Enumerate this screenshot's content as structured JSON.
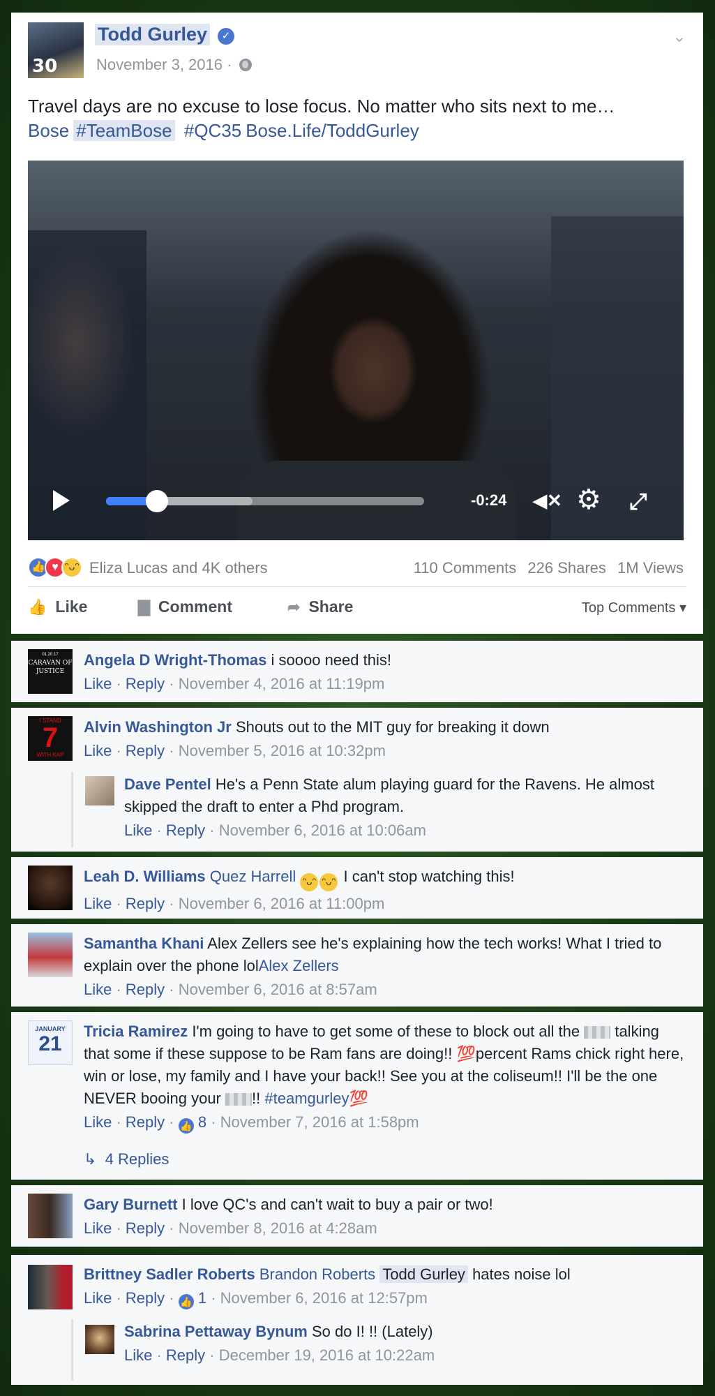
{
  "post": {
    "author": "Todd Gurley",
    "verified_icon": "✓",
    "jersey": "30",
    "date": "November 3, 2016 ·",
    "text": "Travel days are no excuse to lose focus. No matter who sits next to me…",
    "links": [
      "Bose",
      "#TeamBose",
      "#QC35",
      "Bose.Life/ToddGurley"
    ],
    "video": {
      "time_left": "-0:24",
      "progress": 0.16,
      "buffered": 0.46
    },
    "reactions_text": "Eliza Lucas and 4K others",
    "comments_count": "110 Comments",
    "shares_count": "226 Shares",
    "views_count": "1M Views",
    "actions": {
      "like": "Like",
      "comment": "Comment",
      "share": "Share",
      "sort": "Top Comments ▾"
    }
  },
  "comments": [
    {
      "name": "Angela D Wright-Thomas",
      "text": "i soooo need this!",
      "like": "Like",
      "reply": "Reply",
      "date": "November 4, 2016 at 11:19pm"
    },
    {
      "name": "Alvin Washington Jr",
      "text": "Shouts out to the MIT guy for breaking it down",
      "like": "Like",
      "reply": "Reply",
      "date": "November 5, 2016 at 10:32pm",
      "reply_comment": {
        "name": "Dave Pentel",
        "text": "He's a Penn State alum playing guard for the Ravens. He almost skipped the draft to enter a Phd program.",
        "like": "Like",
        "reply": "Reply",
        "date": "November 6, 2016 at 10:06am"
      }
    },
    {
      "name": "Leah D. Williams",
      "tag": "Quez Harrell",
      "text": "I can't stop watching this!",
      "like": "Like",
      "reply": "Reply",
      "date": "November 6, 2016 at 11:00pm"
    },
    {
      "name": "Samantha Khani",
      "text": "Alex Zellers see he's explaining how the tech works! What I tried to explain over the phone lol",
      "tag": "Alex Zellers",
      "like": "Like",
      "reply": "Reply",
      "date": "November 6, 2016 at 8:57am"
    },
    {
      "name": "Tricia Ramirez",
      "text_a": "I'm going to have to get some of these to block out all the",
      "text_b": "talking that some if these suppose to be Ram fans are doing!!",
      "text_c": "percent Rams chick right here, win or lose, my family and I have your back!! See you at the coliseum!! I'll be the one NEVER booing your",
      "text_d": "!!",
      "tag": "#teamgurley",
      "emoji": "💯",
      "like": "Like",
      "reply": "Reply",
      "likes": "8",
      "date": "November 7, 2016 at 1:58pm",
      "replies": "4 Replies"
    },
    {
      "name": "Gary Burnett",
      "text": "I love QC's and can't wait to buy a pair or two!",
      "like": "Like",
      "reply": "Reply",
      "date": "November 8, 2016 at 4:28am"
    },
    {
      "name": "Brittney Sadler Roberts",
      "tag": "Brandon Roberts",
      "tag2": "Todd Gurley",
      "text": "hates noise lol",
      "like": "Like",
      "reply": "Reply",
      "likes": "1",
      "date": "November 6, 2016 at 12:57pm",
      "reply_comment": {
        "name": "Sabrina Pettaway Bynum",
        "text": "So do I! !! (Lately)",
        "like": "Like",
        "reply": "Reply",
        "date": "December 19, 2016 at 10:22am"
      }
    }
  ],
  "avatar_texts": {
    "caravan": "CARAVAN OF JUSTICE",
    "caravan_date": "01.20.17",
    "stand7": "7",
    "stand_top": "I STAND",
    "stand_bot": "WITH KAP",
    "january": "JANUARY",
    "jan_num": "21"
  }
}
